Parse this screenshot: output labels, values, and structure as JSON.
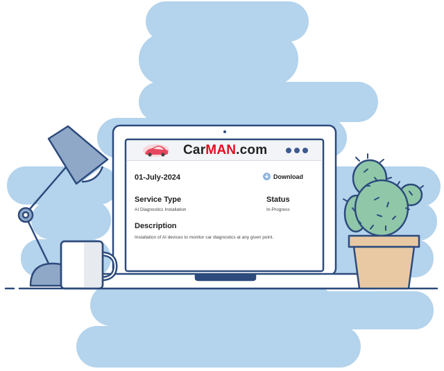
{
  "header": {
    "brand_prefix": "Car",
    "brand_highlight": "MAN",
    "brand_suffix": ".com"
  },
  "service": {
    "date": "01-July-2024",
    "download_label": "Download",
    "service_type_label": "Service Type",
    "service_type_value": "AI Diagnostics Installation",
    "status_label": "Status",
    "status_value": "In-Progress",
    "description_label": "Description",
    "description_value": "Installation of AI devices to monitor car diagnostics at any given point."
  },
  "colors": {
    "brand_accent": "#e0101e",
    "cloud": "#b4d3ec",
    "outline": "#2c4a7c",
    "cactus": "#8fc7a8",
    "pot": "#e8c9a4",
    "lamp": "#8fa8c8"
  },
  "icons": [
    "car-logo-icon",
    "more-dots-icon",
    "download-icon"
  ]
}
